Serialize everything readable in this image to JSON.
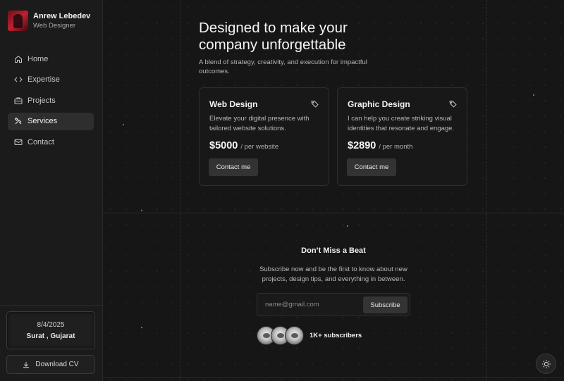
{
  "profile": {
    "name": "Anrew Lebedev",
    "role": "Web Designer"
  },
  "nav": {
    "items": [
      {
        "label": "Home",
        "icon": "home-icon"
      },
      {
        "label": "Expertise",
        "icon": "code-icon"
      },
      {
        "label": "Projects",
        "icon": "briefcase-icon"
      },
      {
        "label": "Services",
        "icon": "tools-icon",
        "active": true
      },
      {
        "label": "Contact",
        "icon": "mail-icon"
      }
    ]
  },
  "sidebar_footer": {
    "date": "8/4/2025",
    "location": "Surat , Gujarat",
    "download_label": "Download CV"
  },
  "hero": {
    "title": "Designed to make your company unforgettable",
    "subtitle": "A blend of strategy, creativity, and execution for impactful outcomes."
  },
  "services": [
    {
      "title": "Web Design",
      "description": "Elevate your digital presence with tailored website solutions.",
      "price": "$5000",
      "unit": "/ per website",
      "button": "Contact me"
    },
    {
      "title": "Graphic Design",
      "description": "I can help you create striking visual identities that resonate and engage.",
      "price": "$2890",
      "unit": "/ per month",
      "button": "Contact me"
    }
  ],
  "newsletter": {
    "title": "Don’t Miss a Beat",
    "subtitle": "Subscribe now and be the first to know about new projects, design tips, and everything in between.",
    "placeholder": "name@gmail.com",
    "button": "Subscribe",
    "subscribers": "1K+ subscribers"
  },
  "colors": {
    "background": "#141414",
    "card": "#181818",
    "button": "#333333",
    "text": "#f2f2f2"
  }
}
